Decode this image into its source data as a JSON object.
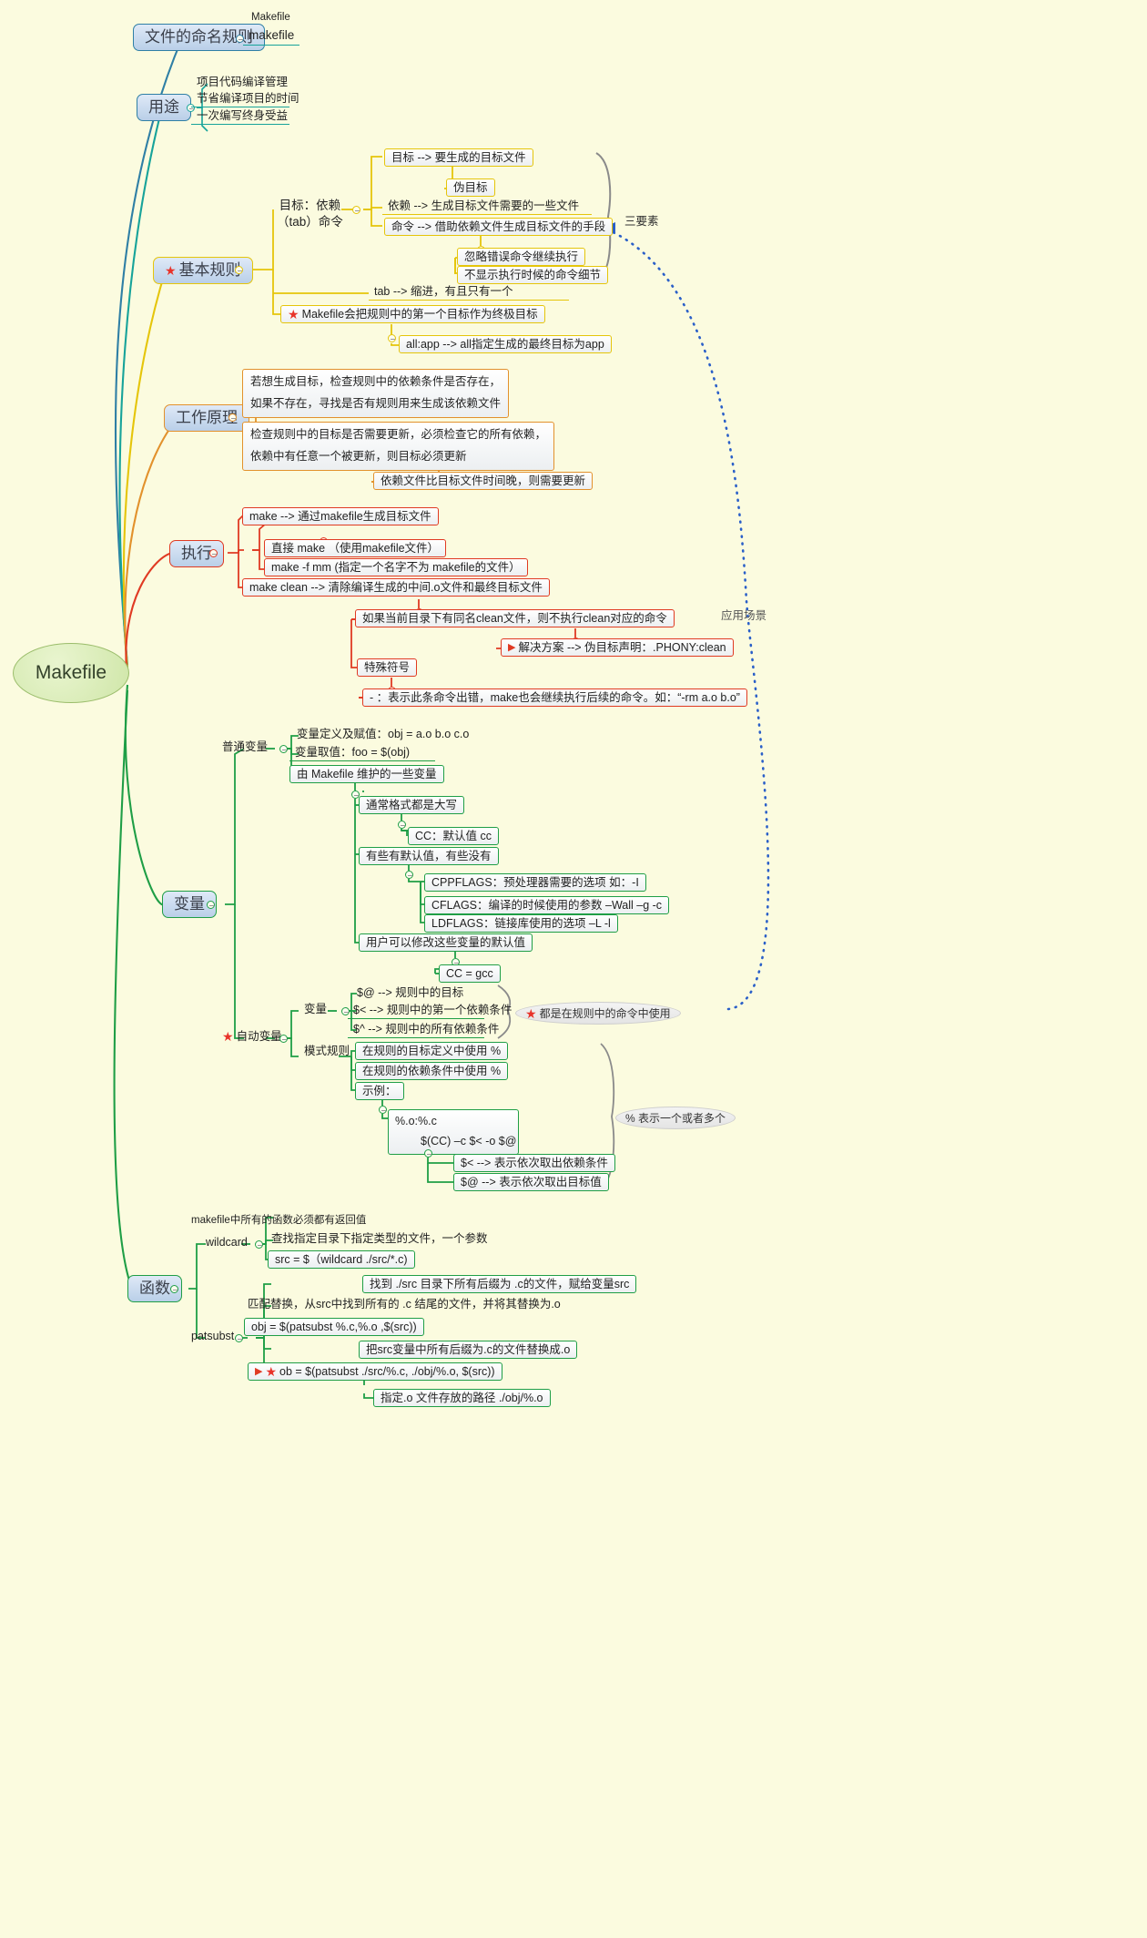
{
  "root": {
    "label": "Makefile"
  },
  "branches": {
    "naming": {
      "title": "文件的命名规则",
      "children": [
        {
          "label": "Makefile"
        },
        {
          "label": "makefile"
        }
      ]
    },
    "usage": {
      "title": "用途",
      "children": [
        {
          "label": "项目代码编译管理"
        },
        {
          "label": "节省编译项目的时间"
        },
        {
          "label": "一次编写终身受益"
        }
      ]
    },
    "basic_rules": {
      "title": "基本规则",
      "starred": true,
      "group_label": "目标：依赖\n（tab）命令",
      "group_line1": "目标：依赖",
      "group_line2": "（tab）命令",
      "items": [
        {
          "label": "目标 --> 要生成的目标文件"
        },
        {
          "label": "伪目标"
        },
        {
          "label": "依赖 --> 生成目标文件需要的一些文件"
        },
        {
          "label": "命令 --> 借助依赖文件生成目标文件的手段"
        },
        {
          "label": "忽略错误命令继续执行"
        },
        {
          "label": "不显示执行时候的命令细节"
        }
      ],
      "tab_rule": "tab --> 缩进，有且只有一个",
      "first_target_rule": "Makefile会把规则中的第一个目标作为终极目标",
      "all_app": "all:app --> all指定生成的最终目标为app",
      "bracket_label": "三要素"
    },
    "principle": {
      "title": "工作原理",
      "items": [
        {
          "line1": "若想生成目标，检查规则中的依赖条件是否存在，",
          "line2": "如果不存在，寻找是否有规则用来生成该依赖文件"
        },
        {
          "line1": "检查规则中的目标是否需要更新，必须检查它的所有依赖，",
          "line2": "依赖中有任意一个被更新，则目标必须更新"
        }
      ],
      "sub": "依赖文件比目标文件时间晚，则需要更新"
    },
    "execute": {
      "title": "执行",
      "items": [
        {
          "label": "make --> 通过makefile生成目标文件"
        },
        {
          "label": "直接 make （使用makefile文件）"
        },
        {
          "label": "make -f mm (指定一个名字不为 makefile的文件）"
        },
        {
          "label": "make clean --> 清除编译生成的中间.o文件和最终目标文件"
        }
      ],
      "clean_note": "如果当前目录下有同名clean文件，则不执行clean对应的命令",
      "solution": "解决方案 --> 伪目标声明：.PHONY:clean",
      "special_symbol": "特殊符号",
      "dash_rule": "- ：表示此条命令出错，make也会继续执行后续的命令。如：“-rm a.o b.o”"
    },
    "variables": {
      "title": "变量",
      "normal_label": "普通变量",
      "normal_items": [
        {
          "label": "变量定义及赋值：obj = a.o b.o c.o"
        },
        {
          "label": "变量取值：foo = $(obj)"
        },
        {
          "label": "由 Makefile 维护的一些变量"
        }
      ],
      "maintained": [
        {
          "label": "通常格式都是大写"
        },
        {
          "label": "CC：默认值 cc"
        },
        {
          "label": "有些有默认值，有些没有"
        },
        {
          "label": "CPPFLAGS：预处理器需要的选项 如：-I"
        },
        {
          "label": "CFLAGS：编译的时候使用的参数 –Wall –g -c"
        },
        {
          "label": "LDFLAGS：链接库使用的选项 –L -l"
        },
        {
          "label": "用户可以修改这些变量的默认值"
        },
        {
          "label": "CC = gcc"
        }
      ],
      "auto_label": "自动变量",
      "auto_var_label": "变量",
      "auto_items": [
        {
          "label": "$@ --> 规则中的目标"
        },
        {
          "label": "$< --> 规则中的第一个依赖条件"
        },
        {
          "label": "$^ --> 规则中的所有依赖条件"
        }
      ],
      "auto_callout": "都是在规则中的命令中使用",
      "pattern_label": "模式规则",
      "pattern_items": [
        {
          "label": "在规则的目标定义中使用 %"
        },
        {
          "label": "在规则的依赖条件中使用 %"
        },
        {
          "label": "示例："
        },
        {
          "label": "%.o:%.c"
        },
        {
          "label": "$(CC) –c  $< -o $@"
        },
        {
          "label": "$< --> 表示依次取出依赖条件"
        },
        {
          "label": "$@ --> 表示依次取出目标值"
        }
      ],
      "pattern_callout": "% 表示一个或者多个"
    },
    "functions": {
      "title": "函数",
      "header_note": "makefile中所有的函数必须都有返回值",
      "wildcard_label": "wildcard",
      "wildcard_items": [
        {
          "label": "查找指定目录下指定类型的文件，一个参数"
        },
        {
          "label": "src = $（wildcard ./src/*.c)"
        },
        {
          "label": "找到 ./src 目录下所有后缀为 .c的文件，赋给变量src"
        }
      ],
      "patsubst_label": "patsubst",
      "patsubst_items": [
        {
          "label": "匹配替换，从src中找到所有的 .c 结尾的文件，并将其替换为.o"
        },
        {
          "label": "obj = $(patsubst %.c,%.o ,$(src))"
        },
        {
          "label": "把src变量中所有后缀为.c的文件替换成.o"
        },
        {
          "label": "ob = $(patsubst ./src/%.c, ./obj/%.o, $(src))"
        },
        {
          "label": "指定.o 文件存放的路径 ./obj/%.o"
        }
      ]
    },
    "scenario_label": "应用场景"
  },
  "colors": {
    "background": "#fbfbdf",
    "blue": "#2f7fa5",
    "teal": "#17a39a",
    "yellow": "#e5c50a",
    "orange": "#e2912c",
    "red": "#e03a23",
    "green": "#1f9e46",
    "root_fill": "#cfe6a8",
    "star": "#e8332a",
    "dotted_arrow": "#2a5fc8"
  }
}
